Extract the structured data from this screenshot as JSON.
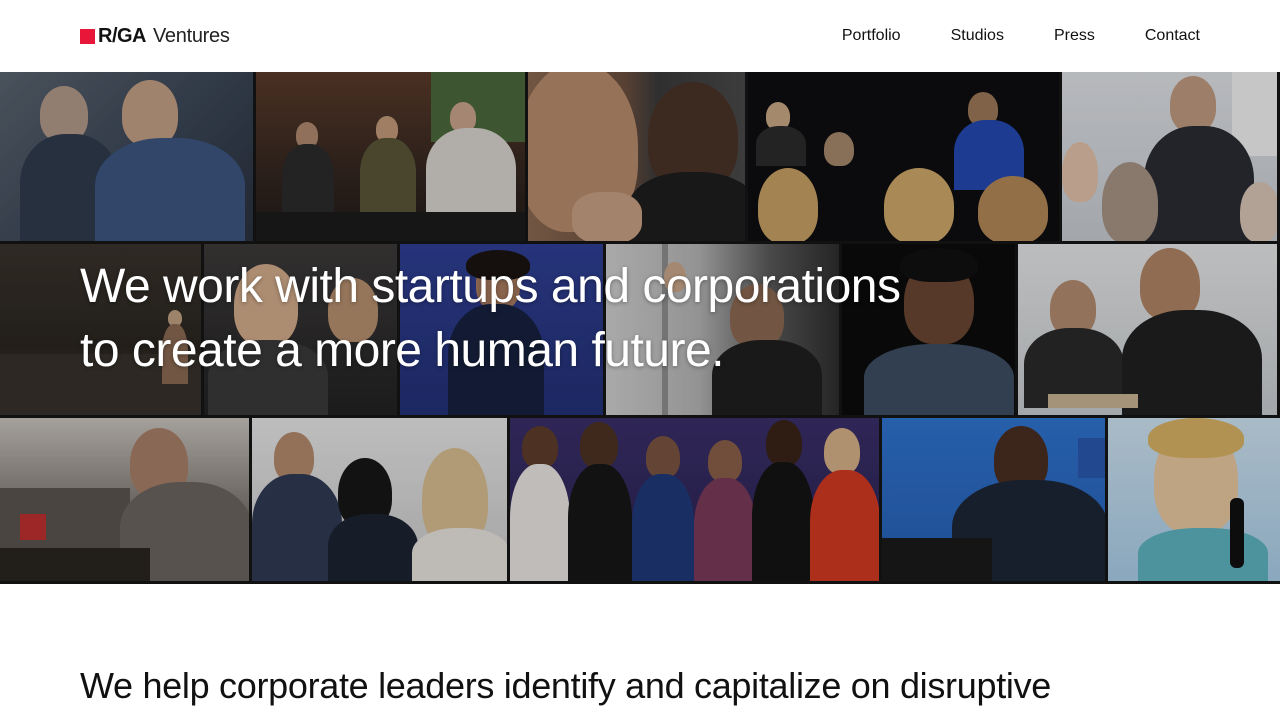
{
  "brand": {
    "mark": "R/GA",
    "word": "Ventures",
    "accent_color": "#e8173a"
  },
  "nav": {
    "items": [
      "Portfolio",
      "Studios",
      "Press",
      "Contact"
    ]
  },
  "hero": {
    "headline_line1": "We work with startups and corporations",
    "headline_line2": "to create a more human future."
  },
  "intro": {
    "text": "We help corporate leaders identify and capitalize on disruptive"
  }
}
